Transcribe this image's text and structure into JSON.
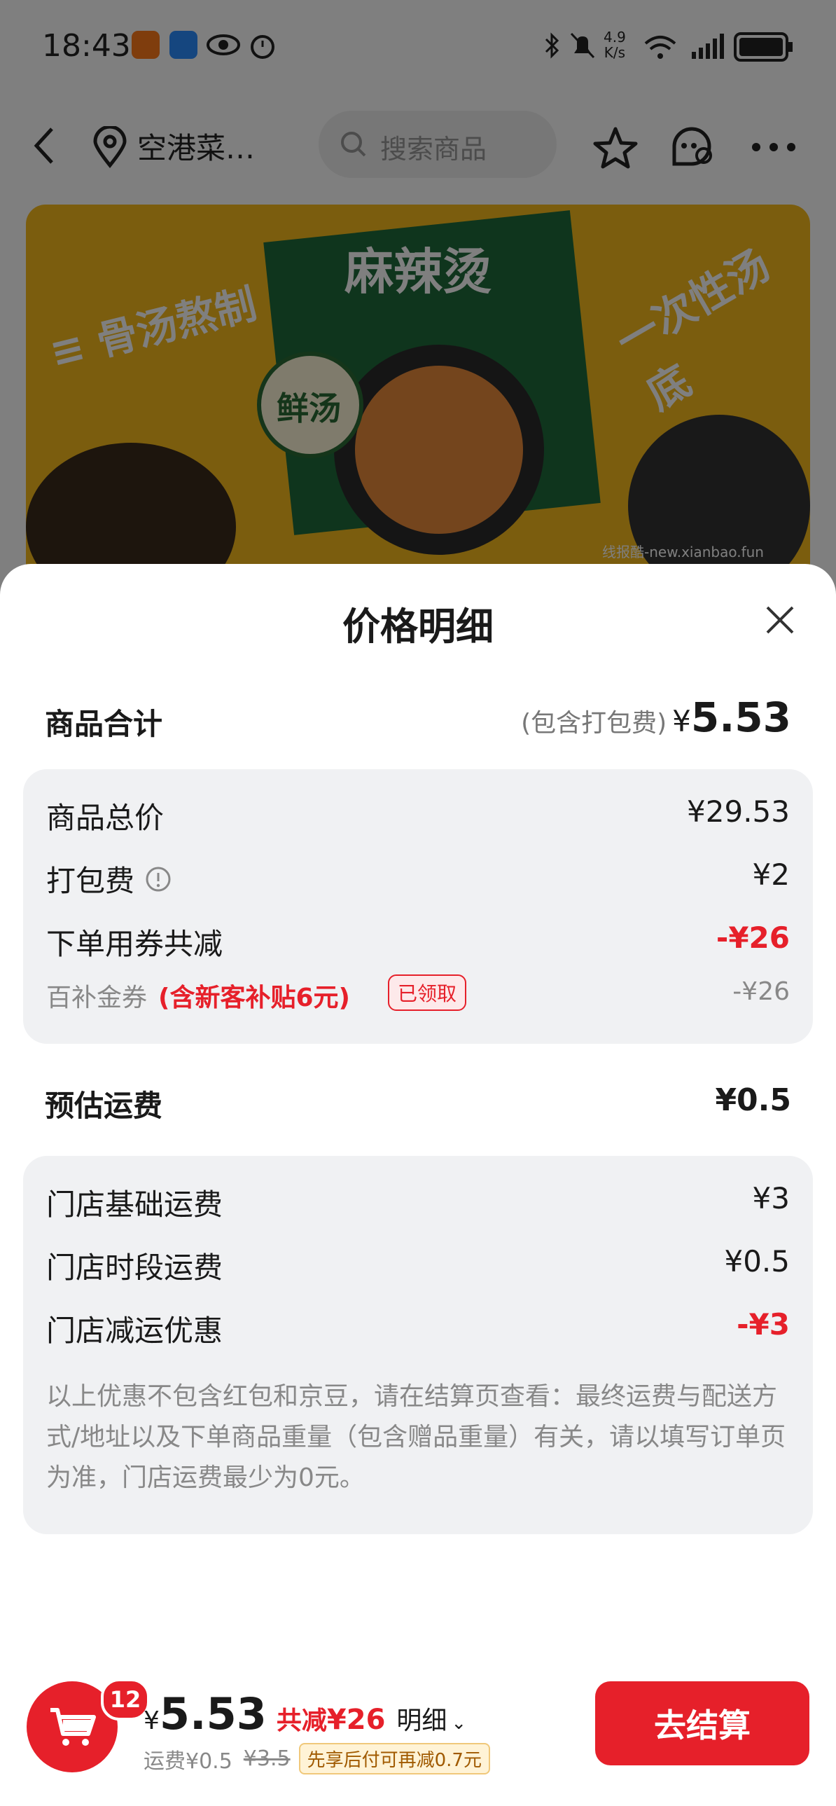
{
  "status_bar": {
    "time": "18:43",
    "net_speed_value": "4.9",
    "net_speed_unit": "K/s"
  },
  "nav": {
    "location": "空港菜…",
    "search_placeholder": "搜索商品"
  },
  "banner": {
    "title": "麻辣烫",
    "left_text": "≡ 骨汤熬制",
    "right_text": "一次性汤底",
    "badge_text": "鲜汤",
    "watermark": "线报酷-new.xianbao.fun"
  },
  "sheet": {
    "title": "价格明细",
    "goods_total": {
      "label": "商品合计",
      "note": "(包含打包费)",
      "currency": "¥",
      "amount": "5.53"
    },
    "goods_items": [
      {
        "label": "商品总价",
        "value": "¥29.53"
      },
      {
        "label": "打包费",
        "value": "¥2"
      },
      {
        "label": "下单用券共减",
        "value": "-¥26"
      }
    ],
    "coupon": {
      "name": "百补金券",
      "desc": "(含新客补贴6元)",
      "tag": "已领取",
      "value": "-¥26"
    },
    "shipping": {
      "label": "预估运费",
      "value": "¥0.5"
    },
    "shipping_items": [
      {
        "label": "门店基础运费",
        "value": "¥3"
      },
      {
        "label": "门店时段运费",
        "value": "¥0.5"
      },
      {
        "label": "门店减运优惠",
        "value": "-¥3"
      }
    ],
    "shipping_note": "以上优惠不包含红包和京豆，请在结算页查看：最终运费与配送方式/地址以及下单商品重量（包含赠品重量）有关，请以填写订单页为准，门店运费最少为0元。"
  },
  "bottom_bar": {
    "cart_count": "12",
    "currency": "¥",
    "total": "5.53",
    "discount_label": "共减",
    "discount": "¥26",
    "detail_label": "明细",
    "ship_fee": "运费¥0.5",
    "ship_orig": "¥3.5",
    "paylater": "先享后付可再减0.7元",
    "checkout_label": "去结算"
  },
  "colors": {
    "accent_red": "#e6202a",
    "card_bg": "#f0f1f3"
  }
}
